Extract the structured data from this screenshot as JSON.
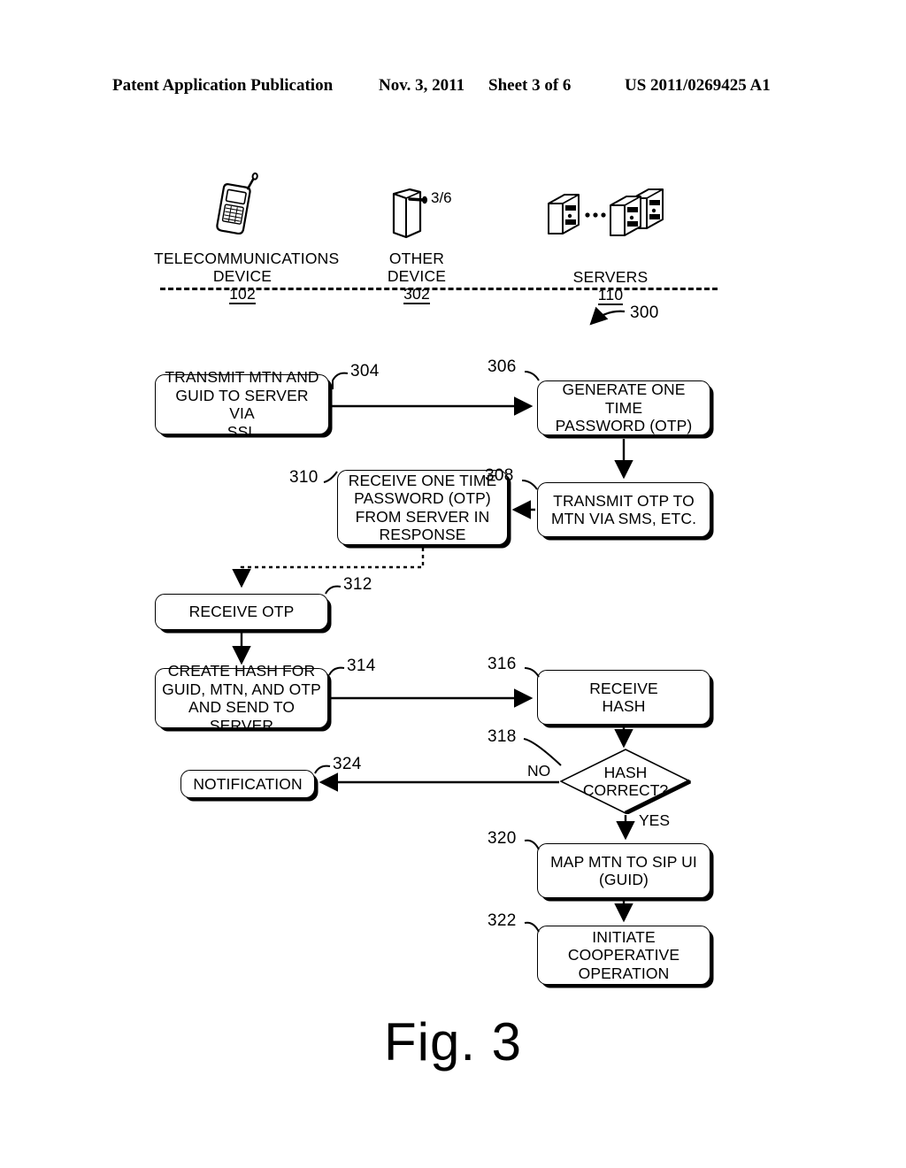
{
  "header": {
    "publication": "Patent Application Publication",
    "date": "Nov. 3, 2011",
    "sheet": "Sheet 3 of 6",
    "patent_number": "US 2011/0269425 A1"
  },
  "figure": {
    "caption": "Fig. 3",
    "diagram_ref": "300",
    "sheet_marker": "3/6"
  },
  "lanes": [
    {
      "name": "telecommunications-device",
      "label": "TELECOMMUNICATIONS\nDEVICE",
      "ref": "102",
      "icon": "mobile-phone-icon"
    },
    {
      "name": "other-device",
      "label": "OTHER\nDEVICE",
      "ref": "302",
      "icon": "tablet-device-icon"
    },
    {
      "name": "servers",
      "label": "SERVERS",
      "ref": "110",
      "icon": "servers-icon"
    }
  ],
  "nodes": [
    {
      "id": "304",
      "ref": "304",
      "label": "TRANSMIT MTN AND\nGUID TO SERVER VIA\nSSL",
      "shape": "rounded-rect"
    },
    {
      "id": "306",
      "ref": "306",
      "label": "GENERATE ONE TIME\nPASSWORD (OTP)",
      "shape": "rounded-rect"
    },
    {
      "id": "308",
      "ref": "308",
      "label": "TRANSMIT OTP TO\nMTN VIA SMS, ETC.",
      "shape": "rounded-rect"
    },
    {
      "id": "310",
      "ref": "310",
      "label": "RECEIVE ONE TIME\nPASSWORD (OTP)\nFROM SERVER IN\nRESPONSE",
      "shape": "rounded-rect"
    },
    {
      "id": "312",
      "ref": "312",
      "label": "RECEIVE OTP",
      "shape": "rounded-rect"
    },
    {
      "id": "314",
      "ref": "314",
      "label": "CREATE HASH FOR\nGUID, MTN, AND OTP\nAND SEND TO SERVER",
      "shape": "rounded-rect"
    },
    {
      "id": "316",
      "ref": "316",
      "label": "RECEIVE\nHASH",
      "shape": "rounded-rect"
    },
    {
      "id": "318",
      "ref": "318",
      "label": "HASH\nCORRECT?",
      "shape": "diamond"
    },
    {
      "id": "320",
      "ref": "320",
      "label": "MAP MTN TO SIP UI\n(GUID)",
      "shape": "rounded-rect"
    },
    {
      "id": "322",
      "ref": "322",
      "label": "INITIATE\nCOOPERATIVE\nOPERATION",
      "shape": "rounded-rect"
    },
    {
      "id": "324",
      "ref": "324",
      "label": "NOTIFICATION",
      "shape": "rounded-rect"
    }
  ],
  "branches": {
    "no_label": "NO",
    "yes_label": "YES"
  },
  "colors": {
    "ink": "#000000",
    "paper": "#ffffff"
  }
}
